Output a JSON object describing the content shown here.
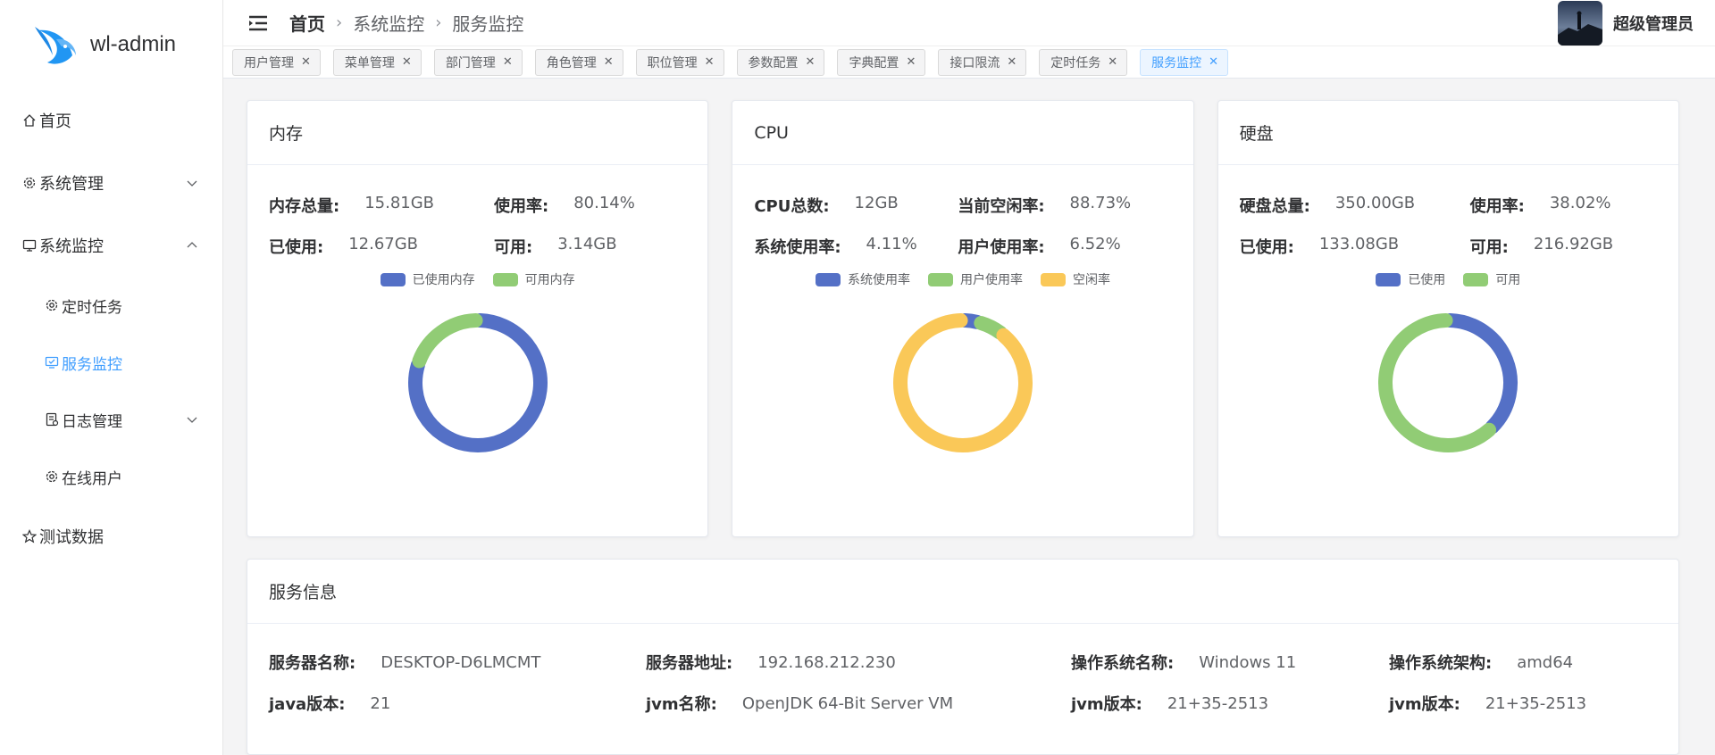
{
  "app": {
    "name": "wl-admin"
  },
  "sidebar": {
    "items": [
      {
        "label": "首页",
        "icon": "home-icon"
      },
      {
        "label": "系统管理",
        "icon": "gear-icon"
      },
      {
        "label": "系统监控",
        "icon": "monitor-icon"
      },
      {
        "label": "定时任务",
        "icon": "gear-icon"
      },
      {
        "label": "服务监控",
        "icon": "monitor-check-icon",
        "active": true
      },
      {
        "label": "日志管理",
        "icon": "log-icon"
      },
      {
        "label": "在线用户",
        "icon": "gear-icon"
      },
      {
        "label": "测试数据",
        "icon": "star-icon"
      }
    ]
  },
  "header": {
    "breadcrumb": [
      "首页",
      "系统监控",
      "服务监控"
    ],
    "user_name": "超级管理员"
  },
  "tags": [
    "用户管理",
    "菜单管理",
    "部门管理",
    "角色管理",
    "职位管理",
    "参数配置",
    "字典配置",
    "接口限流",
    "定时任务",
    "服务监控"
  ],
  "colors": {
    "accent": "#409eff",
    "blue": "#5470c6",
    "green": "#91cc75",
    "yellow": "#fac858"
  },
  "memory": {
    "title": "内存",
    "total_label": "内存总量:",
    "total": "15.81GB",
    "usage_label": "使用率:",
    "usage": "80.14%",
    "used_label": "已使用:",
    "used": "12.67GB",
    "avail_label": "可用:",
    "avail": "3.14GB",
    "legend": [
      "已使用内存",
      "可用内存"
    ]
  },
  "cpu": {
    "title": "CPU",
    "count_label": "CPU总数:",
    "count": "12GB",
    "idle_label": "当前空闲率:",
    "idle": "88.73%",
    "sys_label": "系统使用率:",
    "sys": "4.11%",
    "user_label": "用户使用率:",
    "user": "6.52%",
    "legend": [
      "系统使用率",
      "用户使用率",
      "空闲率"
    ]
  },
  "disk": {
    "title": "硬盘",
    "total_label": "硬盘总量:",
    "total": "350.00GB",
    "usage_label": "使用率:",
    "usage": "38.02%",
    "used_label": "已使用:",
    "used": "133.08GB",
    "avail_label": "可用:",
    "avail": "216.92GB",
    "legend": [
      "已使用",
      "可用"
    ]
  },
  "chart_data": [
    {
      "type": "pie",
      "categories": [
        "已使用内存",
        "可用内存"
      ],
      "values": [
        80.14,
        19.86
      ]
    },
    {
      "type": "pie",
      "categories": [
        "系统使用率",
        "用户使用率",
        "空闲率"
      ],
      "values": [
        4.11,
        6.52,
        88.73
      ]
    },
    {
      "type": "pie",
      "categories": [
        "已使用",
        "可用"
      ],
      "values": [
        38.02,
        61.98
      ]
    }
  ],
  "server": {
    "title": "服务信息",
    "row1": [
      {
        "label": "服务器名称:",
        "value": "DESKTOP-D6LMCMT"
      },
      {
        "label": "服务器地址:",
        "value": "192.168.212.230"
      },
      {
        "label": "操作系统名称:",
        "value": "Windows 11"
      },
      {
        "label": "操作系统架构:",
        "value": "amd64"
      }
    ],
    "row2": [
      {
        "label": "java版本:",
        "value": "21"
      },
      {
        "label": "jvm名称:",
        "value": "OpenJDK 64-Bit Server VM"
      },
      {
        "label": "jvm版本:",
        "value": "21+35-2513"
      },
      {
        "label": "jvm版本:",
        "value": "21+35-2513"
      }
    ]
  }
}
